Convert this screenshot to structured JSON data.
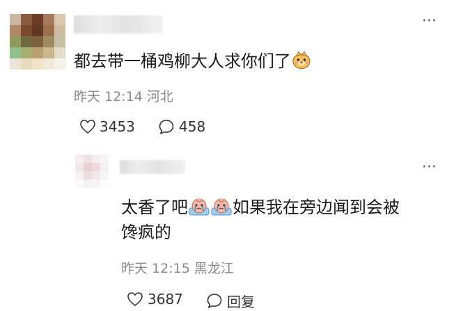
{
  "comment": {
    "text": "都去带一桶鸡柳大人求你们了",
    "emoji": "dog-face-emoji",
    "time": "昨天 12:14",
    "location": "河北",
    "likes": "3453",
    "replies": "458"
  },
  "reply": {
    "text_line1_a": "太香了吧",
    "text_line1_b": "如果我在旁边闻到会被",
    "text_line2": "馋疯的",
    "emoji": "crying-face-emoji",
    "time": "昨天 12:15",
    "location": "黑龙江",
    "likes": "3687",
    "reply_label": "回复"
  },
  "colors": {
    "text": "#1a1a1a",
    "meta": "#8a8a8a",
    "icon": "#333333"
  }
}
